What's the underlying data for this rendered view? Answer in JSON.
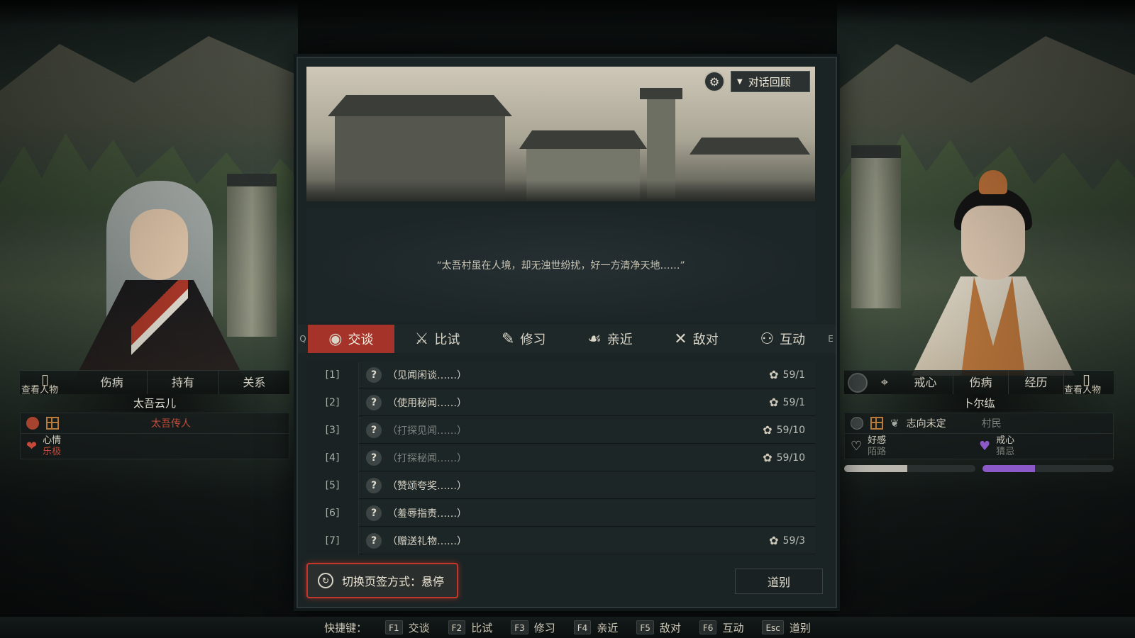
{
  "top_title": "",
  "banner": {
    "review_label": "对话回顾",
    "settings_icon": "gear-icon",
    "review_icon": "chevron-down-icon"
  },
  "quote": "“太吾村虽在人境，却无浊世纷扰，好一方清净天地……”",
  "action_tabs": {
    "prev_key": "Q",
    "next_key": "E",
    "items": [
      {
        "label": "交谈",
        "icon": "chat-icon",
        "active": true
      },
      {
        "label": "比试",
        "icon": "crossed-swords-icon",
        "active": false
      },
      {
        "label": "修习",
        "icon": "scroll-icon",
        "active": false
      },
      {
        "label": "亲近",
        "icon": "hand-icon",
        "active": false
      },
      {
        "label": "敌对",
        "icon": "sword-icon",
        "active": false
      },
      {
        "label": "互动",
        "icon": "people-icon",
        "active": false
      }
    ]
  },
  "options": [
    {
      "num": "[1]",
      "text": "（见闻闲谈……）",
      "cost": "59/1",
      "dim": false
    },
    {
      "num": "[2]",
      "text": "（使用秘闻……）",
      "cost": "59/1",
      "dim": false
    },
    {
      "num": "[3]",
      "text": "（打探见闻……）",
      "cost": "59/10",
      "dim": true
    },
    {
      "num": "[4]",
      "text": "（打探秘闻……）",
      "cost": "59/10",
      "dim": true
    },
    {
      "num": "[5]",
      "text": "（赞颂夸奖……）",
      "cost": "",
      "dim": false
    },
    {
      "num": "[6]",
      "text": "（羞辱指责……）",
      "cost": "",
      "dim": false
    },
    {
      "num": "[7]",
      "text": "（赠送礼物……）",
      "cost": "59/3",
      "dim": false
    }
  ],
  "switch_label": "切换页签方式：悬停",
  "bye_label": "道别",
  "left_panel": {
    "view_label": "查看人物",
    "tabs": [
      "伤病",
      "持有",
      "关系"
    ],
    "name": "太吾云儿",
    "title": "太吾传人",
    "mood_label": "心情",
    "mood_value": "乐极"
  },
  "right_panel": {
    "view_label": "查看人物",
    "tabs": [
      "戒心",
      "伤病",
      "经历"
    ],
    "name": "卜尔纮",
    "ambition": "志向未定",
    "identity": "村民",
    "favor_label": "好感",
    "favor_value": "陌路",
    "guard_label": "戒心",
    "guard_value": "猜忌",
    "favor_bar": 0.48,
    "guard_bar": 0.4,
    "colors": {
      "favor": "#b9b6ae",
      "guard": "#8b5ac8"
    }
  },
  "shortcuts": {
    "label": "快捷键：",
    "items": [
      {
        "key": "F1",
        "label": "交谈"
      },
      {
        "key": "F2",
        "label": "比试"
      },
      {
        "key": "F3",
        "label": "修习"
      },
      {
        "key": "F4",
        "label": "亲近"
      },
      {
        "key": "F5",
        "label": "敌对"
      },
      {
        "key": "F6",
        "label": "互动"
      },
      {
        "key": "Esc",
        "label": "道别"
      }
    ]
  }
}
